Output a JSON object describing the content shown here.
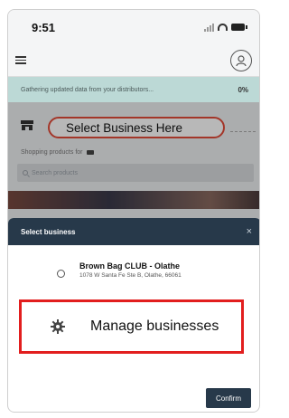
{
  "status_bar": {
    "time": "9:51"
  },
  "progress": {
    "message": "Gathering updated data from your distributors...",
    "percent": "0%"
  },
  "business_selector": {
    "label": "Select Business Here",
    "shopping_for": "Shopping products for"
  },
  "search": {
    "placeholder": "Search products"
  },
  "modal": {
    "title": "Select business",
    "close_label": "×",
    "option": {
      "name": "Brown Bag CLUB - Olathe",
      "address": "1078 W Santa Fe Ste B, Olathe, 66061"
    },
    "manage_label": "Manage businesses",
    "confirm_label": "Confirm"
  },
  "colors": {
    "accent": "#27394a",
    "highlight_red": "#e21e1e",
    "oval_red": "#e24b3a",
    "strip_teal": "#bcd9d6"
  },
  "icons": [
    "menu-icon",
    "user-icon",
    "store-icon",
    "truck-icon",
    "search-icon",
    "close-icon",
    "gear-icon"
  ]
}
